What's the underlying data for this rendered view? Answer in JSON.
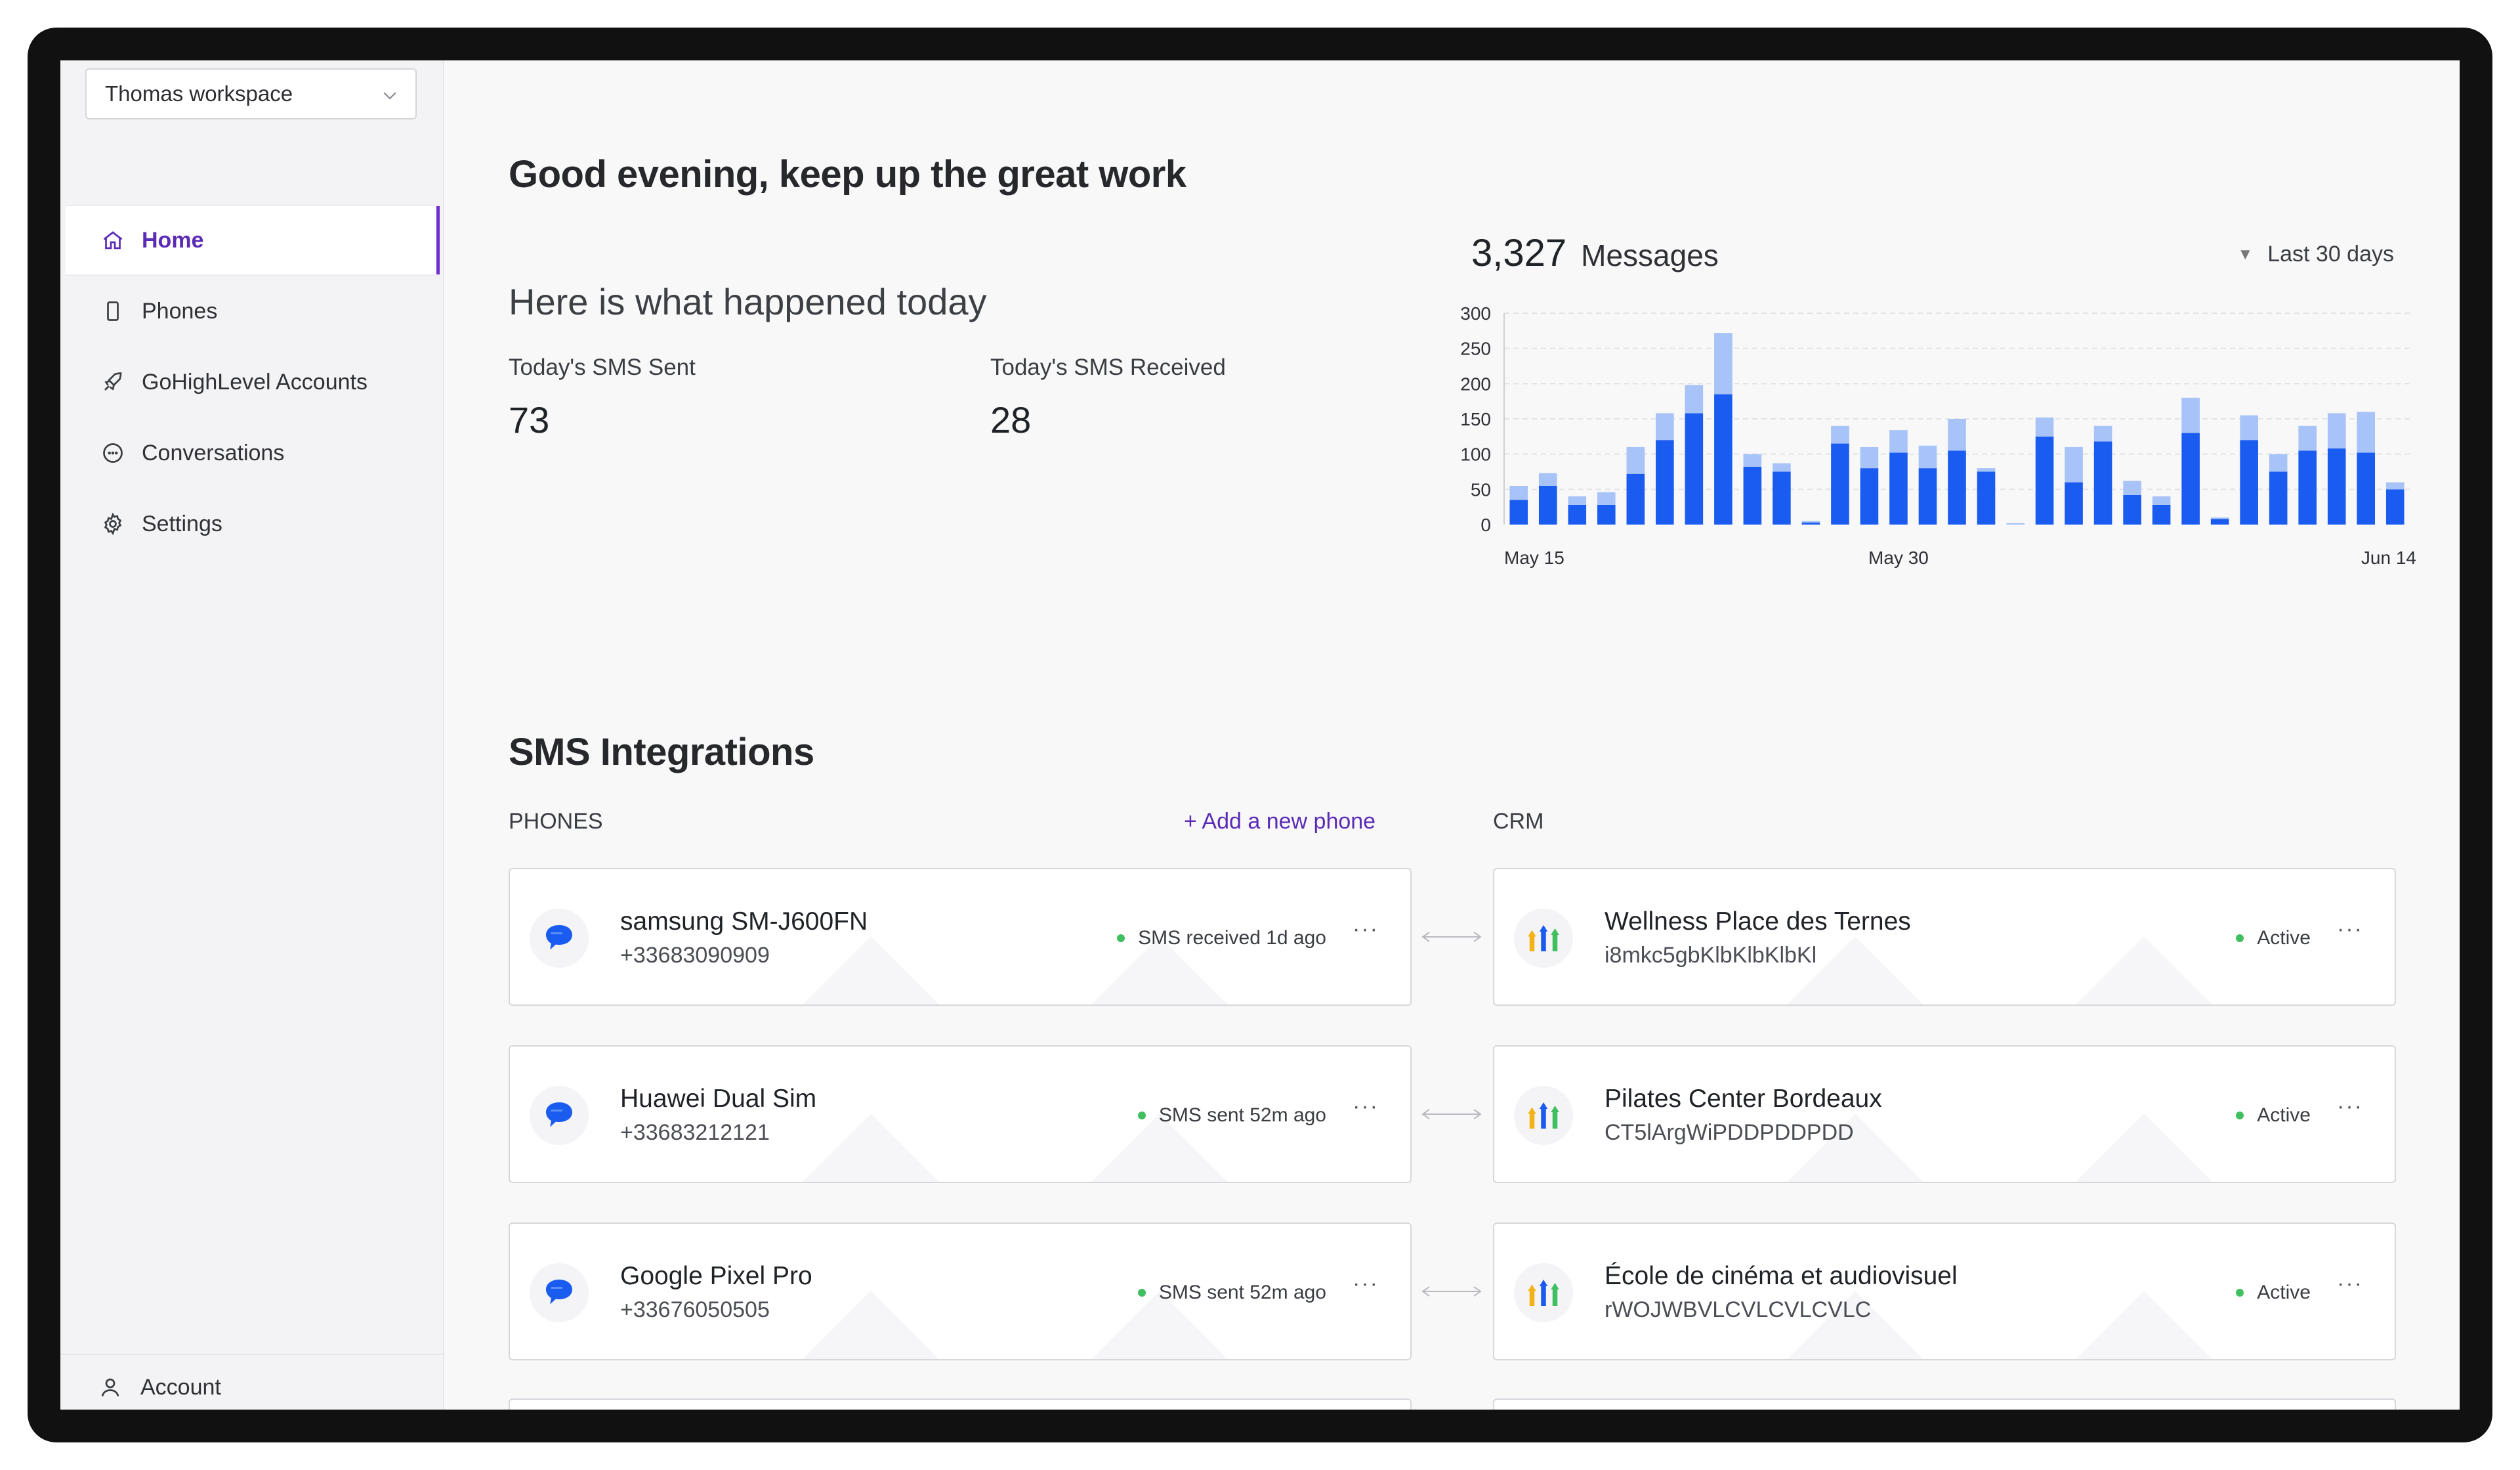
{
  "workspace": {
    "name": "Thomas workspace",
    "icon": "chevron-down-icon"
  },
  "nav": {
    "items": [
      {
        "label": "Home",
        "icon": "home-icon",
        "active": true
      },
      {
        "label": "Phones",
        "icon": "phone-icon",
        "active": false
      },
      {
        "label": "GoHighLevel Accounts",
        "icon": "rocket-icon",
        "active": false
      },
      {
        "label": "Conversations",
        "icon": "chat-icon",
        "active": false
      },
      {
        "label": "Settings",
        "icon": "gear-icon",
        "active": false
      }
    ],
    "account_label": "Account"
  },
  "greeting": "Good evening, keep up the great work",
  "today": {
    "heading": "Here is what happened today",
    "sent_label": "Today's SMS Sent",
    "sent_value": "73",
    "received_label": "Today's SMS Received",
    "received_value": "28"
  },
  "messages": {
    "total": "3,327",
    "label": "Messages",
    "range_label": "Last 30 days"
  },
  "chart_data": {
    "type": "bar",
    "stacked": true,
    "x_tick_labels": [
      "May 15",
      "May 30",
      "Jun 14"
    ],
    "x_tick_positions": [
      0,
      13,
      30
    ],
    "ylim": [
      0,
      300
    ],
    "yticks": [
      0,
      50,
      100,
      150,
      200,
      250,
      300
    ],
    "grid": true,
    "series": [
      {
        "color": "#1a5cf0",
        "values": [
          35,
          55,
          28,
          28,
          72,
          120,
          158,
          185,
          82,
          75,
          3,
          115,
          80,
          102,
          80,
          105,
          75,
          0,
          125,
          60,
          118,
          42,
          28,
          130,
          8,
          120,
          75,
          105,
          108,
          102,
          50
        ]
      },
      {
        "color": "#a7c3f7",
        "values": [
          20,
          18,
          12,
          18,
          38,
          38,
          40,
          87,
          18,
          12,
          2,
          25,
          30,
          32,
          32,
          45,
          5,
          2,
          27,
          50,
          22,
          20,
          12,
          50,
          2,
          35,
          25,
          35,
          50,
          58,
          10
        ]
      }
    ]
  },
  "integrations": {
    "title": "SMS Integrations",
    "phones_label": "PHONES",
    "add_phone_label": "+ Add a new phone",
    "crm_label": "CRM",
    "phones": [
      {
        "name": "samsung SM-J600FN",
        "number": "+33683090909",
        "status": "SMS received 1d ago",
        "icon": "message-bubble-icon"
      },
      {
        "name": "Huawei Dual Sim",
        "number": "+33683212121",
        "status": "SMS sent 52m ago",
        "icon": "message-bubble-icon"
      },
      {
        "name": "Google Pixel Pro",
        "number": "+33676050505",
        "status": "SMS sent 52m ago",
        "icon": "message-bubble-icon"
      }
    ],
    "crms": [
      {
        "name": "Wellness Place des Ternes",
        "id": "i8mkc5gbKlbKlbKlbKl",
        "status": "Active",
        "icon": "gohighlevel-logo-icon"
      },
      {
        "name": "Pilates Center Bordeaux",
        "id": "CT5lArgWiPDDPDDPDD",
        "status": "Active",
        "icon": "gohighlevel-logo-icon"
      },
      {
        "name": "École de cinéma et audiovisuel",
        "id": "rWOJWBVLCVLCVLCVLC",
        "status": "Active",
        "icon": "gohighlevel-logo-icon"
      }
    ],
    "more_label": "···"
  },
  "colors": {
    "accent": "#5b2bb7",
    "bar_primary": "#1a5cf0",
    "bar_secondary": "#a7c3f7",
    "status_green": "#3fbf5f"
  }
}
